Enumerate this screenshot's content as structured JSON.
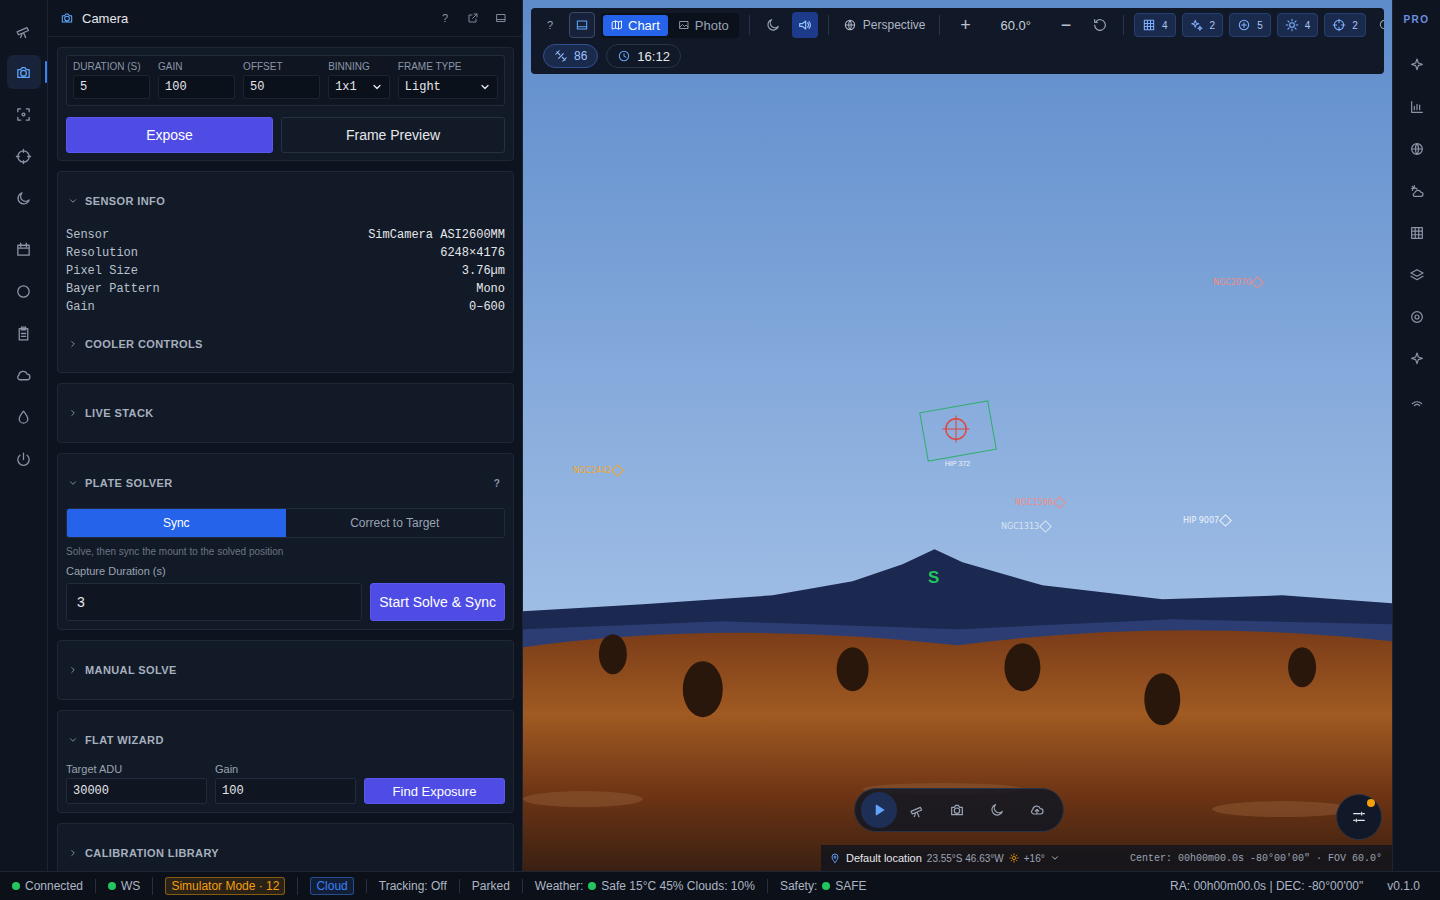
{
  "left_rail": [
    {
      "selected": false
    },
    {
      "selected": true
    },
    {
      "selected": false
    },
    {
      "selected": false
    },
    {
      "selected": false
    },
    {
      "selected": false
    },
    {
      "selected": false
    },
    {
      "selected": false
    },
    {
      "selected": false
    },
    {
      "selected": false
    },
    {
      "selected": false
    }
  ],
  "right_rail": {
    "edition": "PRO"
  },
  "camera_panel": {
    "title": "Camera",
    "help": "?",
    "exposure_fields": [
      {
        "label": "DURATION (S)",
        "value": "5",
        "kind": "input"
      },
      {
        "label": "GAIN",
        "value": "100",
        "kind": "input"
      },
      {
        "label": "OFFSET",
        "value": "50",
        "kind": "input"
      },
      {
        "label": "BINNING",
        "value": "1x1",
        "kind": "select"
      },
      {
        "label": "FRAME TYPE",
        "value": "Light",
        "kind": "select"
      }
    ],
    "expose_button": "Expose",
    "preview_button": "Frame Preview",
    "sensor_info": {
      "title": "SENSOR INFO",
      "expanded": true,
      "rows": [
        {
          "key": "Sensor",
          "value": "SimCamera ASI2600MM"
        },
        {
          "key": "Resolution",
          "value": "6248×4176"
        },
        {
          "key": "Pixel Size",
          "value": "3.76µm"
        },
        {
          "key": "Bayer Pattern",
          "value": "Mono"
        },
        {
          "key": "Gain",
          "value": "0–600"
        }
      ]
    },
    "cooler_controls": {
      "title": "COOLER CONTROLS",
      "expanded": false
    },
    "live_stack": {
      "title": "LIVE STACK",
      "expanded": false
    },
    "plate_solver": {
      "title": "PLATE SOLVER",
      "expanded": true,
      "help": "?",
      "modes": [
        {
          "label": "Sync",
          "selected": true
        },
        {
          "label": "Correct to Target",
          "selected": false
        }
      ],
      "hint": "Solve, then sync the mount to the solved position",
      "duration_label": "Capture Duration (s)",
      "duration_value": "3",
      "start_button": "Start Solve & Sync"
    },
    "manual_solve": {
      "title": "MANUAL SOLVE",
      "expanded": false
    },
    "flat_wizard": {
      "title": "FLAT WIZARD",
      "expanded": true,
      "fields": [
        {
          "label": "Target ADU",
          "value": "30000"
        },
        {
          "label": "Gain",
          "value": "100"
        }
      ],
      "button": "Find Exposure"
    },
    "calibration_library": {
      "title": "CALIBRATION LIBRARY",
      "expanded": false
    }
  },
  "chart": {
    "toolbar": {
      "help": "?",
      "view_modes": [
        {
          "label": "Chart",
          "selected": true
        },
        {
          "label": "Photo",
          "selected": false
        }
      ],
      "night_mode": false,
      "sound_on": true,
      "projection": "Perspective",
      "zoom_in": "+",
      "fov": "60.0°",
      "zoom_out": "−",
      "overlay_chips": [
        {
          "count": "4"
        },
        {
          "count": "2"
        },
        {
          "count": "5"
        },
        {
          "count": "4"
        },
        {
          "count": "2"
        }
      ],
      "object_count": "86",
      "time": "16:12"
    },
    "markers": [
      {
        "label": "NGC2070",
        "color": "#f28b82"
      },
      {
        "label": "NGC2442",
        "color": "#f5a623"
      },
      {
        "label": "NGC1566",
        "color": "#f28b82"
      },
      {
        "label": "NGC1313",
        "color": "#dbe4f2"
      },
      {
        "label": "HIP 9007",
        "color": "#eef3fb"
      }
    ],
    "target": {
      "label": "HIP 372"
    },
    "cardinal": {
      "label": "S",
      "color": "#22c55e"
    },
    "controls": [
      {
        "selected": true
      },
      {
        "selected": false
      },
      {
        "selected": false
      },
      {
        "selected": false
      },
      {
        "selected": false
      }
    ],
    "settings": {
      "notification": true
    },
    "location_bar": {
      "location": "Default location",
      "coords": "23.55°S 46.63°W",
      "sun": "+16°",
      "center": "Center: 00h00m00.0s -80°00'00\" · FOV 60.0°"
    }
  },
  "status_bar": {
    "left": [
      {
        "text": "Connected",
        "kind": "dot",
        "color": "#22c55e"
      },
      {
        "text": "WS",
        "kind": "dot",
        "color": "#22c55e"
      },
      {
        "text": "Simulator Mode · 12",
        "kind": "badge",
        "color": "#f59e0b"
      },
      {
        "text": "Cloud",
        "kind": "badge",
        "color": "#3b82f6"
      },
      {
        "text": "Tracking: Off",
        "kind": "plain"
      },
      {
        "text": "Parked",
        "kind": "plain"
      },
      {
        "label": "Weather:",
        "text": "Safe 15°C 45% Clouds: 10%",
        "kind": "labeled-dot",
        "color": "#22c55e"
      },
      {
        "label": "Safety:",
        "text": "SAFE",
        "kind": "labeled-dot",
        "color": "#22c55e"
      }
    ],
    "right": [
      {
        "text": "RA: 00h00m00.0s | DEC: -80°00'00\""
      },
      {
        "text": "v0.1.0"
      }
    ]
  }
}
